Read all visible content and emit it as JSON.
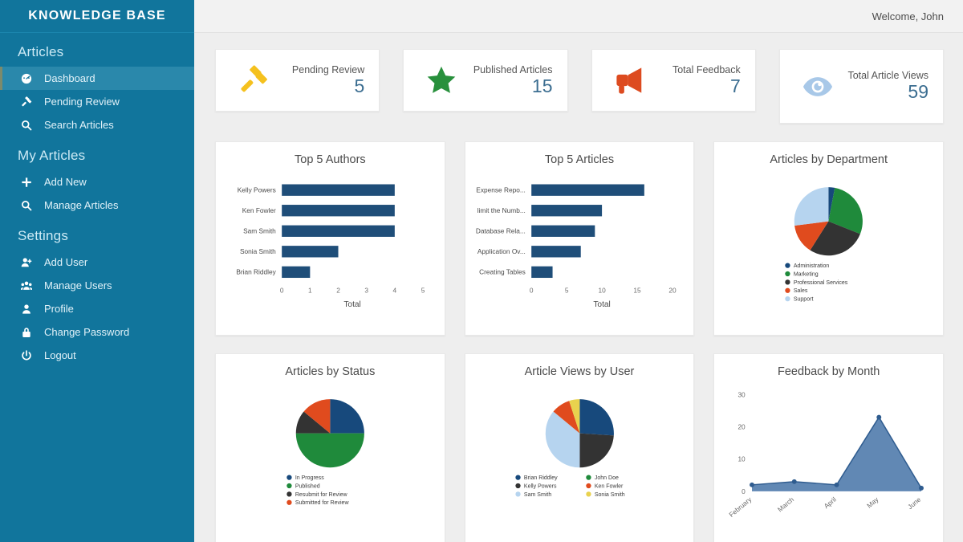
{
  "brand": {
    "title": "KNOWLEDGE BASE"
  },
  "topbar": {
    "welcome": "Welcome, John"
  },
  "sidebar": {
    "groups": [
      {
        "title": "Articles",
        "items": [
          {
            "label": "Dashboard",
            "icon": "dashboard-icon",
            "active": true
          },
          {
            "label": "Pending Review",
            "icon": "gavel-icon",
            "active": false
          },
          {
            "label": "Search Articles",
            "icon": "search-icon",
            "active": false
          }
        ]
      },
      {
        "title": "My Articles",
        "items": [
          {
            "label": "Add New",
            "icon": "plus-icon",
            "active": false
          },
          {
            "label": "Manage Articles",
            "icon": "search-icon",
            "active": false
          }
        ]
      },
      {
        "title": "Settings",
        "items": [
          {
            "label": "Add User",
            "icon": "user-plus-icon",
            "active": false
          },
          {
            "label": "Manage Users",
            "icon": "users-icon",
            "active": false
          },
          {
            "label": "Profile",
            "icon": "user-icon",
            "active": false
          },
          {
            "label": "Change Password",
            "icon": "lock-icon",
            "active": false
          },
          {
            "label": "Logout",
            "icon": "power-icon",
            "active": false
          }
        ]
      }
    ]
  },
  "kpis": [
    {
      "label": "Pending Review",
      "value": "5",
      "icon": "gavel-icon",
      "color": "#f5c11e"
    },
    {
      "label": "Published Articles",
      "value": "15",
      "icon": "star-icon",
      "color": "#28903c"
    },
    {
      "label": "Total Feedback",
      "value": "7",
      "icon": "megaphone-icon",
      "color": "#dd4b20"
    },
    {
      "label": "Total Article Views",
      "value": "59",
      "icon": "eye-icon",
      "color": "#a8c8e8"
    }
  ],
  "chart_data": [
    {
      "id": "top-authors",
      "type": "bar",
      "orientation": "horizontal",
      "title": "Top 5 Authors",
      "categories": [
        "Kelly Powers",
        "Ken Fowler",
        "Sam Smith",
        "Sonia Smith",
        "Brian Riddley"
      ],
      "values": [
        4,
        4,
        4,
        2,
        1
      ],
      "xlabel": "Total",
      "ylabel": "",
      "xlim": [
        0,
        5
      ],
      "xticks": [
        0,
        1,
        2,
        3,
        4,
        5
      ],
      "grid": false,
      "legend": "none",
      "color": "#1f4e79"
    },
    {
      "id": "top-articles",
      "type": "bar",
      "orientation": "horizontal",
      "title": "Top 5 Articles",
      "categories": [
        "Expense Repo...",
        "limit the Numb...",
        "Database Rela...",
        "Application Ov...",
        "Creating Tables"
      ],
      "values": [
        16,
        10,
        9,
        7,
        3
      ],
      "xlabel": "Total",
      "ylabel": "",
      "xlim": [
        0,
        20
      ],
      "xticks": [
        0,
        5,
        10,
        15,
        20
      ],
      "grid": false,
      "legend": "none",
      "color": "#1f4e79"
    },
    {
      "id": "articles-by-department",
      "type": "pie",
      "title": "Articles by Department",
      "labels": [
        "Administration",
        "Marketing",
        "Professional Services",
        "Sales",
        "Support"
      ],
      "values": [
        3,
        28,
        28,
        14,
        27
      ],
      "colors": [
        "#17497c",
        "#1f8a3b",
        "#333333",
        "#e04b1e",
        "#b6d4ef"
      ],
      "legend": "bottom"
    },
    {
      "id": "articles-by-status",
      "type": "pie",
      "title": "Articles by Status",
      "labels": [
        "In Progress",
        "Published",
        "Resubmit for Review",
        "Submitted for Review"
      ],
      "values": [
        25,
        50,
        11,
        14
      ],
      "colors": [
        "#17497c",
        "#1f8a3b",
        "#333333",
        "#e04b1e"
      ],
      "legend": "bottom"
    },
    {
      "id": "article-views-by-user",
      "type": "pie",
      "title": "Article Views by User",
      "labels": [
        "Brian Riddley",
        "Kelly Powers",
        "Sam Smith",
        "John Doe",
        "Ken Fowler",
        "Sonia Smith"
      ],
      "values": [
        26,
        24,
        36,
        0,
        9,
        5
      ],
      "colors": [
        "#17497c",
        "#333333",
        "#b6d4ef",
        "#1f8a3b",
        "#e04b1e",
        "#e9d24e"
      ],
      "legend": "bottom-two-column"
    },
    {
      "id": "feedback-by-month",
      "type": "area",
      "title": "Feedback by Month",
      "categories": [
        "February",
        "March",
        "April",
        "May",
        "June"
      ],
      "values": [
        2,
        3,
        2,
        23,
        1
      ],
      "ylim": [
        0,
        30
      ],
      "yticks": [
        0,
        10,
        20,
        30
      ],
      "grid": false,
      "legend": "none",
      "color": "#4573a7"
    }
  ]
}
